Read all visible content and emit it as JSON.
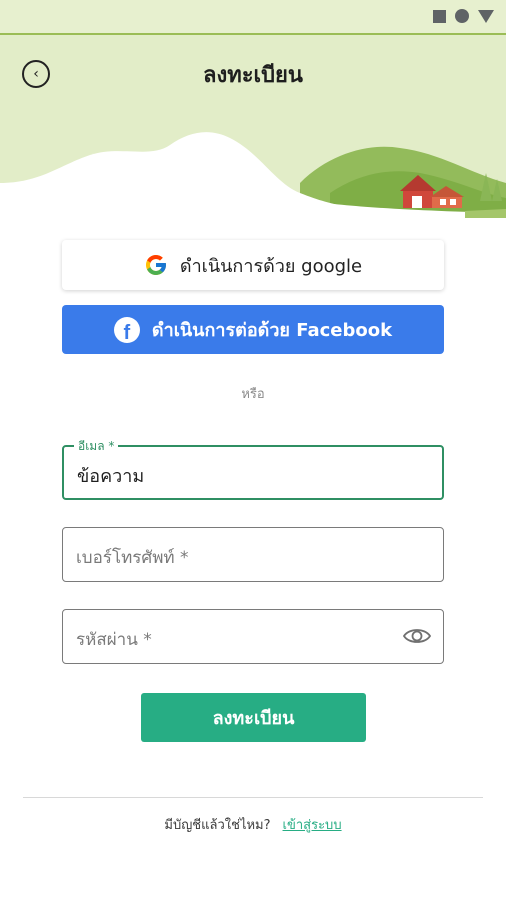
{
  "status_bar": {
    "icons": [
      "square-icon",
      "circle-icon",
      "triangle-icon"
    ]
  },
  "header": {
    "title": "ลงทะเบียน",
    "back_icon": "chevron-left-icon"
  },
  "social": {
    "google_label": "ดำเนินการด้วย google",
    "facebook_label": "ดำเนินการต่อด้วย Facebook"
  },
  "divider_text": "หรือ",
  "form": {
    "email": {
      "label": "อีเมล *",
      "value": "ข้อความ"
    },
    "phone": {
      "placeholder": "เบอร์โทรศัพท์ *"
    },
    "password": {
      "placeholder": "รหัสผ่าน *",
      "icon": "eye-icon"
    }
  },
  "register_button": "ลงทะเบียน",
  "footer": {
    "question": "มีบัญชีแล้วใช่ไหม?",
    "login_link": "เข้าสู่ระบบ"
  },
  "colors": {
    "header_bg": "#e2edc8",
    "primary_green": "#27ad84",
    "facebook_blue": "#3a7bea"
  }
}
